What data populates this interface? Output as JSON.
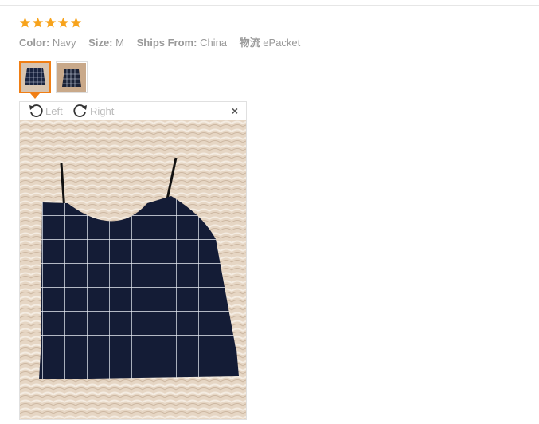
{
  "review": {
    "rating": 5,
    "star_color": "#f7a31c",
    "attributes": [
      {
        "key": "Color:",
        "value": "Navy"
      },
      {
        "key": "Size:",
        "value": "M"
      },
      {
        "key": "Ships From:",
        "value": "China"
      },
      {
        "key": "物流",
        "value": "ePacket"
      }
    ]
  },
  "viewer": {
    "rotate_left_label": "Left",
    "rotate_right_label": "Right",
    "close_glyph": "×",
    "accent_color": "#f07e14"
  },
  "icons": [
    "star-icon",
    "rotate-left-icon",
    "rotate-right-icon",
    "close-icon"
  ]
}
